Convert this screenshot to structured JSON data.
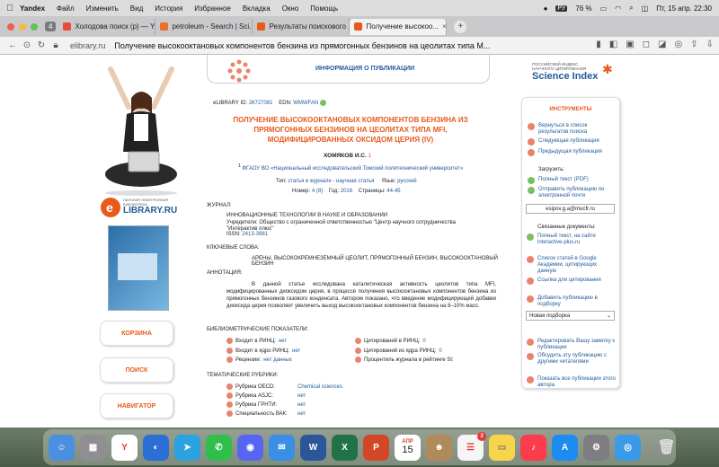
{
  "menubar": {
    "app": "Yandex",
    "items": [
      "Файл",
      "Изменить",
      "Вид",
      "История",
      "Избранное",
      "Вкладка",
      "Окно",
      "Помощь"
    ],
    "lang": "РУ",
    "battery": "76 %",
    "datetime": "Пт, 15 апр.  22:30"
  },
  "tabs": {
    "count": "4",
    "items": [
      {
        "label": "Холодова поиск (р) — Y...",
        "color": "#e74c3c"
      },
      {
        "label": "petroleum - Search | Sci...",
        "color": "#e8702a"
      },
      {
        "label": "Результаты поискового ...",
        "color": "#e85a1b"
      },
      {
        "label": "Получение высокоо...",
        "color": "#e85a1b",
        "active": true
      }
    ]
  },
  "address": {
    "host": "elibrary.ru",
    "title": "Получение высокооктановых компонентов бензина из прямогонных бензинов на цеолитах типа M..."
  },
  "left": {
    "logo_small": "НАУЧНАЯ ЭЛЕКТРОННАЯ БИБЛИОТЕКА",
    "logo_big": "LIBRARY.RU",
    "buttons": [
      "КОРЗИНА",
      "ПОИСК",
      "НАВИГАТОР"
    ]
  },
  "center": {
    "header": "ИНФОРМАЦИЯ О ПУБЛИКАЦИИ",
    "id_label": "eLIBRARY ID:",
    "id_value": "26727081",
    "edn_label": "EDN:",
    "edn_value": "WMWFAN",
    "title": "ПОЛУЧЕНИЕ ВЫСОКООКТАНОВЫХ КОМПОНЕНТОВ БЕНЗИНА ИЗ ПРЯМОГОННЫХ БЕНЗИНОВ НА ЦЕОЛИТАХ ТИПА MFI, МОДИФИЦИРОВАННЫХ ОКСИДОМ ЦЕРИЯ (IV)",
    "author": "ХОМЯКОВ И.С.",
    "affil_num": "1",
    "affil": "ФГАОУ ВО «Национальный исследовательский Томский политехнический университет»",
    "type_label": "Тип:",
    "type_value": "статья в журнале - научная статья",
    "lang_label": "Язык:",
    "lang_value": "русский",
    "num_label": "Номер:",
    "num_value": "4 (8)",
    "year_label": "Год:",
    "year_value": "2016",
    "pages_label": "Страницы:",
    "pages_value": "44-45",
    "journal_label": "ЖУРНАЛ:",
    "journal_name": "ИННОВАЦИОННЫЕ ТЕХНОЛОГИИ В НАУКЕ И ОБРАЗОВАНИИ",
    "founders": "Учредители: Общество с ограниченной ответственностью \"Центр научного сотрудничества \"Интерактив плюс\"",
    "issn_label": "ISSN:",
    "issn_value": "2413-3981",
    "kw_label": "КЛЮЧЕВЫЕ СЛОВА:",
    "keywords": "АРЕНЫ, ВЫСОКОКРЕМНЕЗЕМНЫЙ ЦЕОЛИТ, ПРЯМОГОННЫЙ БЕНЗИН, ВЫСОКООКТАНОВЫЙ БЕНЗИН",
    "ann_label": "АННОТАЦИЯ:",
    "annotation": "В данной статье исследована каталитическая активность цеолитов типа MFI, модифицированных диоксидом церия, в процессе получения высокооктановых компонентов бензина из прямогонных бензинов газового конденсата. Автором показано, что введение модифицирующей добавки диоксида церия позволяет увеличить выход высокооктановых компонентов бензина на 8–10% масс.",
    "biblio_label": "БИБЛИОМЕТРИЧЕСКИЕ ПОКАЗАТЕЛИ:",
    "biblio_left": [
      {
        "label": "Входит в РИНЦ:",
        "value": "нет"
      },
      {
        "label": "Входит в ядро РИНЦ:",
        "value": "нет"
      },
      {
        "label": "Рецензии:",
        "value": "нет данных"
      }
    ],
    "biblio_right": [
      {
        "label": "Цитирований в РИНЦ:",
        "value": "0"
      },
      {
        "label": "Цитирований из ядра РИНЦ:",
        "value": "0"
      },
      {
        "label": "Процентиль журнала в рейтинге SI:",
        "value": ""
      }
    ],
    "rubrics_label": "ТЕМАТИЧЕСКИЕ РУБРИКИ:",
    "rubrics": [
      {
        "label": "Рубрика OECD:",
        "value": "Chemical sciences"
      },
      {
        "label": "Рубрика ASJC:",
        "value": "нет"
      },
      {
        "label": "Рубрика ГРНТИ:",
        "value": "нет"
      },
      {
        "label": "Специальность ВАК:",
        "value": "нет"
      }
    ]
  },
  "right": {
    "sci_small": "РОССИЙСКИЙ ИНДЕКС НАУЧНОГО ЦИТИРОВАНИЯ",
    "sci_big": "Science Index",
    "tools_label": "ИНСТРУМЕНТЫ",
    "nav_items": [
      "Вернуться в список результатов поиска",
      "Следующая публикация",
      "Предыдущая публикация"
    ],
    "download_label": "Загрузить:",
    "download_items": [
      "Полный текст (PDF)",
      "Отправить публикацию по электронной почте"
    ],
    "email": "esipov.g.a@mucfr.ru",
    "related_label": "Связанные документы:",
    "related_items": [
      "Полный текст, на сайте interactive-plus.ru"
    ],
    "other_items": [
      "Список статей в Google Академии, цитирующих данную",
      "Ссылка для цитирования",
      "Добавить публикацию в подборку"
    ],
    "select_value": "Новая подборка",
    "bottom_items": [
      "Редактировать Вашу заметку к публикации",
      "Обсудить эту публикацию с другими читателями",
      "Показать все публикации этого автора"
    ]
  },
  "dock": {
    "calendar_month": "АПР",
    "calendar_day": "15",
    "badge": "3"
  }
}
